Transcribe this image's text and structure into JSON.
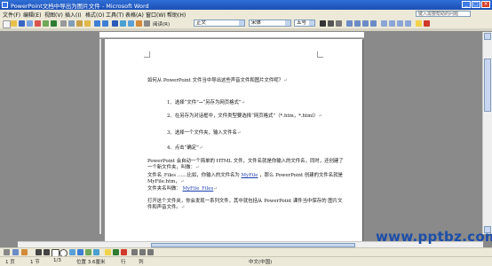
{
  "window": {
    "title": "PowerPoint文档中导出为图片文件 - Microsoft Word"
  },
  "menu": {
    "items": [
      "文件(F)",
      "编辑(E)",
      "视图(V)",
      "插入(I)",
      "格式(O)",
      "工具(T)",
      "表格(A)",
      "窗口(W)",
      "帮助(H)"
    ]
  },
  "help_box": {
    "placeholder": "键入需要帮助的问题"
  },
  "toolbar": {
    "style_value": "正文",
    "font_value": "宋体",
    "size_value": "五号",
    "read_label": "阅读(R)"
  },
  "document": {
    "lines": [
      "如何从 PowerPoint 文件当中导出这些声音文件和图片文件呢？",
      "1、选择“文件”→“另存为网页格式”",
      "2、在另存为对话框中，文件类型要选择“网页格式”（*.htm，*.html）",
      "3、选择一个文件夹，输入文件名",
      "4、点击“确定”",
      "PowerPoint 会自动一个简单的 HTML 文件，文件名就是你输入的文件名，同时，还创建了",
      "一个新文件夹，叫做：",
      "文件名_Files ……比如，你输入的文件名为",
      "，那么 PowerPoint 创建的文件名就是",
      "MyFile.htm，",
      "文件夹名叫做：",
      "打开这个文件夹，你会发现一系列文件，其中就包括从 PowerPoint 课件当中保存的 图片文",
      "件和声音文件。"
    ],
    "inline": {
      "myfile": "MyFile",
      "myfile_files": "MyFile_Files"
    }
  },
  "status": {
    "page": "1 页",
    "section": "1 节",
    "page_of": "1/3",
    "position": "位置 3.6厘米",
    "row": "行",
    "col": "列",
    "lang": "中文(中国)"
  },
  "watermark": "www.pptbz.com",
  "colors": {
    "titlebar": "#1b4fb5",
    "link": "#1a3db0",
    "chrome": "#ece9d8"
  }
}
